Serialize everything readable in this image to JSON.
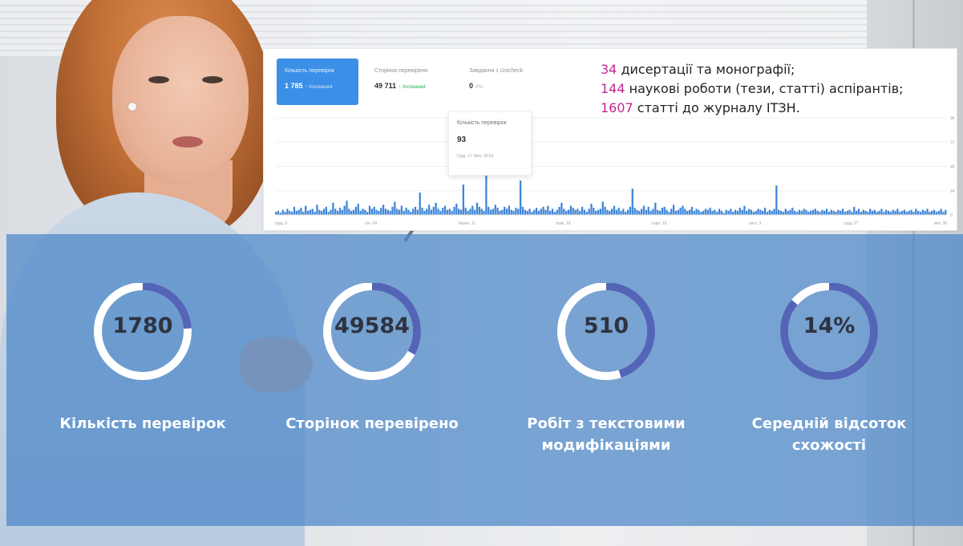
{
  "dashboard": {
    "tabs": [
      {
        "label": "Кількість перевірок",
        "value": "1 785",
        "note": "↑ Increased"
      },
      {
        "label": "Сторінок перевірено",
        "value": "49 711",
        "note": "↑ Increased"
      },
      {
        "label": "Завдання з Unicheck",
        "value": "0",
        "note": "0%"
      }
    ],
    "tooltip": {
      "title": "Кількість перевірок",
      "value": "93",
      "date": "Срд, 17 Квіт. 2019"
    },
    "stats": [
      {
        "number": "34",
        "text": " дисертації та монографії;"
      },
      {
        "number": "144",
        "text": " наукові роботи (тези, статті) аспірантів;"
      },
      {
        "number": "1607",
        "text": " статті до журналу ІТЗН."
      }
    ],
    "colors": {
      "accent": "#3b8fe6",
      "bars": "#3f86d8",
      "increase": "#27a74a",
      "highlight": "#c02891"
    }
  },
  "chart_data": {
    "type": "bar",
    "x_ticks": [
      "груд. 5",
      "січ. 24",
      "берез. 11",
      "трав. 18",
      "серп. 19",
      "лист. 3",
      "груд. 27",
      "квіт. 30"
    ],
    "y_ticks": [
      "0",
      "24",
      "48",
      "72",
      "96"
    ],
    "ylim": [
      0,
      96
    ],
    "values": [
      3,
      4,
      2,
      5,
      3,
      6,
      4,
      3,
      8,
      4,
      5,
      7,
      3,
      9,
      4,
      5,
      6,
      3,
      10,
      5,
      4,
      6,
      8,
      3,
      5,
      12,
      6,
      4,
      7,
      5,
      9,
      14,
      6,
      4,
      5,
      8,
      11,
      4,
      6,
      5,
      3,
      9,
      6,
      8,
      5,
      4,
      7,
      10,
      6,
      5,
      4,
      8,
      13,
      6,
      5,
      9,
      4,
      7,
      5,
      3,
      6,
      8,
      5,
      22,
      7,
      4,
      6,
      10,
      5,
      8,
      12,
      6,
      4,
      7,
      9,
      5,
      6,
      4,
      8,
      11,
      6,
      5,
      30,
      7,
      4,
      6,
      9,
      5,
      12,
      8,
      6,
      4,
      93,
      8,
      5,
      6,
      10,
      7,
      4,
      5,
      8,
      6,
      9,
      5,
      4,
      7,
      6,
      34,
      8,
      5,
      4,
      6,
      3,
      5,
      7,
      4,
      6,
      8,
      5,
      9,
      4,
      6,
      3,
      5,
      8,
      12,
      6,
      4,
      5,
      9,
      7,
      5,
      6,
      4,
      8,
      5,
      3,
      6,
      11,
      7,
      4,
      5,
      6,
      13,
      8,
      5,
      4,
      6,
      9,
      5,
      7,
      4,
      6,
      3,
      5,
      8,
      26,
      7,
      5,
      4,
      6,
      9,
      5,
      8,
      4,
      6,
      12,
      5,
      4,
      7,
      8,
      5,
      3,
      6,
      10,
      4,
      5,
      7,
      9,
      6,
      4,
      5,
      8,
      4,
      6,
      5,
      3,
      4,
      6,
      5,
      7,
      4,
      5,
      3,
      6,
      4,
      2,
      5,
      4,
      6,
      3,
      5,
      4,
      7,
      5,
      9,
      4,
      6,
      5,
      3,
      4,
      6,
      5,
      4,
      7,
      3,
      5,
      4,
      6,
      29,
      5,
      4,
      3,
      6,
      4,
      5,
      7,
      4,
      3,
      5,
      4,
      6,
      5,
      3,
      4,
      5,
      6,
      4,
      3,
      5,
      4,
      6,
      3,
      5,
      4,
      3,
      5,
      4,
      6,
      3,
      4,
      5,
      3,
      8,
      4,
      6,
      3,
      5,
      4,
      3,
      6,
      4,
      5,
      3,
      4,
      6,
      3,
      5,
      4,
      3,
      5,
      4,
      6,
      3,
      4,
      5,
      3,
      4,
      5,
      3,
      6,
      4,
      3,
      5,
      4,
      6,
      3,
      4,
      5,
      3,
      4,
      6,
      3,
      5
    ]
  },
  "metrics": [
    {
      "value": "1780",
      "label": "Кількість перевірок",
      "fraction": 0.24
    },
    {
      "value": "49584",
      "label": "Сторінок перевірено",
      "fraction": 0.33
    },
    {
      "value": "510",
      "label": "Робіт з текстовими модифікаціями",
      "fraction": 0.45
    },
    {
      "value": "14%",
      "label": "Середній відсоток схожості",
      "fraction": 0.86
    }
  ],
  "metric_colors": {
    "ring_fill": "#5465b7",
    "ring_track": "#ffffff"
  }
}
